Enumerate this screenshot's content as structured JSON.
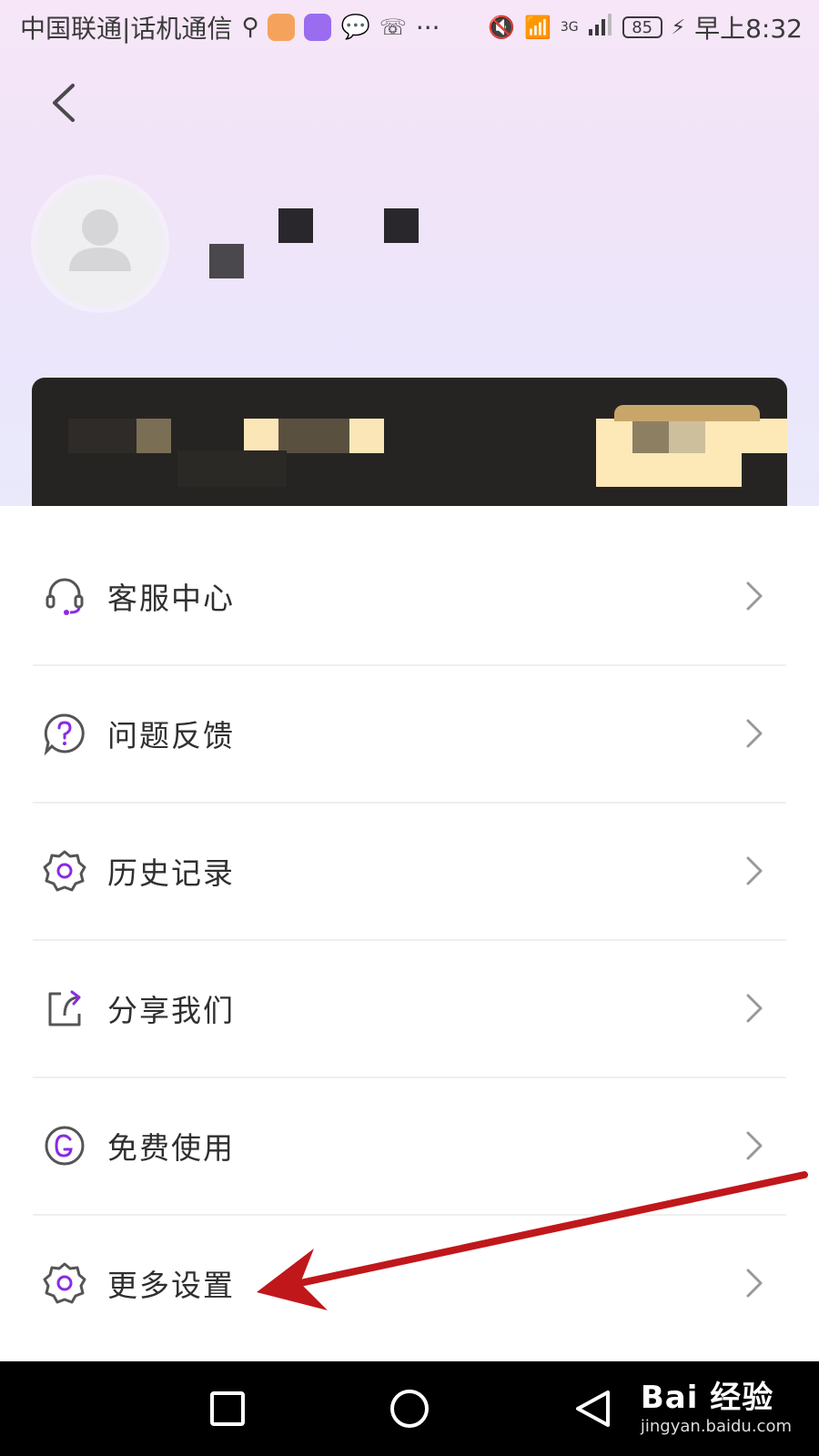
{
  "status_bar": {
    "carrier": "中国联通|话机通信",
    "network": "3G",
    "battery": "85",
    "time": "早上8:32",
    "more": "···"
  },
  "menu": {
    "items": [
      {
        "label": "客服中心",
        "icon": "headset-icon"
      },
      {
        "label": "问题反馈",
        "icon": "question-bubble-icon"
      },
      {
        "label": "历史记录",
        "icon": "gear-icon"
      },
      {
        "label": "分享我们",
        "icon": "share-icon"
      },
      {
        "label": "免费使用",
        "icon": "g-circle-icon"
      },
      {
        "label": "更多设置",
        "icon": "gear-icon"
      }
    ]
  },
  "watermark": {
    "brand": "Bai 经验",
    "url": "jingyan.baidu.com"
  },
  "colors": {
    "accent": "#8a2be2",
    "annotation_arrow": "#c0171b",
    "card_bg": "#262422",
    "gold": "#fde8b8"
  }
}
